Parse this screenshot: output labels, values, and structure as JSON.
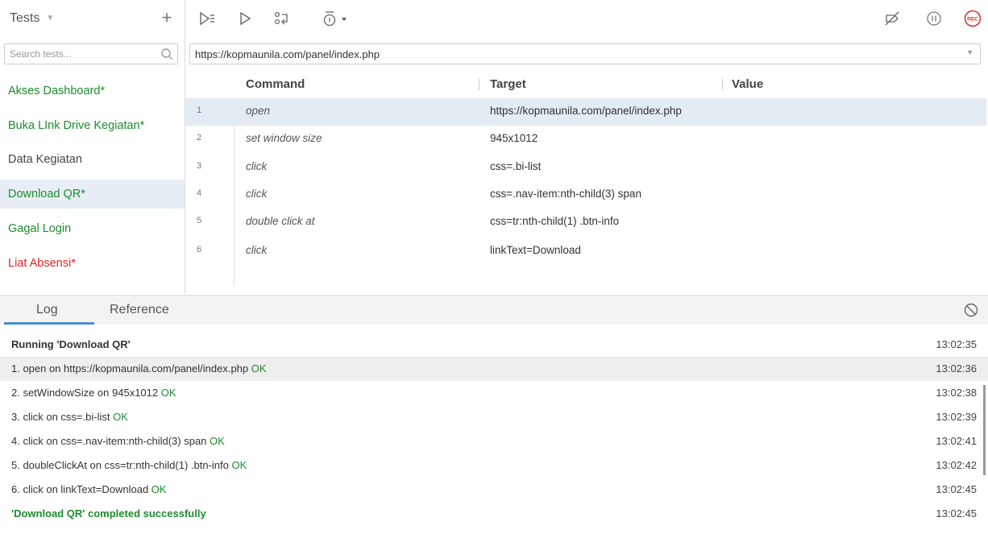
{
  "sidebar": {
    "title": "Tests",
    "add_symbol": "+",
    "search_placeholder": "Search tests...",
    "tests": [
      {
        "label": "Akses Dashboard*",
        "color": "#1e8c2d"
      },
      {
        "label": "Buka LInk Drive Kegiatan*",
        "color": "#1e8c2d"
      },
      {
        "label": "Data Kegiatan",
        "color": "#444444"
      },
      {
        "label": "Download QR*",
        "color": "#1e8c2d",
        "selected": true
      },
      {
        "label": "Gagal Login",
        "color": "#1e8c2d"
      },
      {
        "label": "Liat Absensi*",
        "color": "#e02424"
      }
    ]
  },
  "toolbar": {
    "icons": [
      "run-all-icon",
      "run-current-icon",
      "step-icon",
      "speed-icon",
      "disable-breakpoints-icon",
      "pause-icon",
      "record-icon"
    ],
    "record_label": "REC"
  },
  "url": {
    "value": "https://kopmaunila.com/panel/index.php"
  },
  "table": {
    "headers": {
      "command": "Command",
      "target": "Target",
      "value": "Value"
    },
    "rows": [
      {
        "num": "1",
        "command": "open",
        "target": "https://kopmaunila.com/panel/index.php",
        "selected": true
      },
      {
        "num": "2",
        "command": "set window size",
        "target": "945x1012"
      },
      {
        "num": "3",
        "command": "click",
        "target": "css=.bi-list"
      },
      {
        "num": "4",
        "command": "click",
        "target": "css=.nav-item:nth-child(3) span"
      },
      {
        "num": "5",
        "command": "double click at",
        "target": "css=tr:nth-child(1) .btn-info"
      },
      {
        "num": "6",
        "command": "click",
        "target": "linkText=Download"
      }
    ]
  },
  "panel": {
    "tabs": [
      "Log",
      "Reference"
    ],
    "log": [
      {
        "text": "Running 'Download QR'",
        "ok": "",
        "time": "13:02:35",
        "bold": true
      },
      {
        "text": "1.  open on https://kopmaunila.com/panel/index.php ",
        "ok": "OK",
        "time": "13:02:36",
        "highlight": true
      },
      {
        "text": "2.  setWindowSize on 945x1012 ",
        "ok": "OK",
        "time": "13:02:38"
      },
      {
        "text": "3.  click on css=.bi-list ",
        "ok": "OK",
        "time": "13:02:39"
      },
      {
        "text": "4.  click on css=.nav-item:nth-child(3) span ",
        "ok": "OK",
        "time": "13:02:41"
      },
      {
        "text": "5.  doubleClickAt on css=tr:nth-child(1) .btn-info ",
        "ok": "OK",
        "time": "13:02:42"
      },
      {
        "text": "6.  click on linkText=Download ",
        "ok": "OK",
        "time": "13:02:45"
      },
      {
        "text": "'Download QR' completed successfully",
        "ok": "",
        "time": "13:02:45",
        "bold": true,
        "success": true
      }
    ]
  }
}
